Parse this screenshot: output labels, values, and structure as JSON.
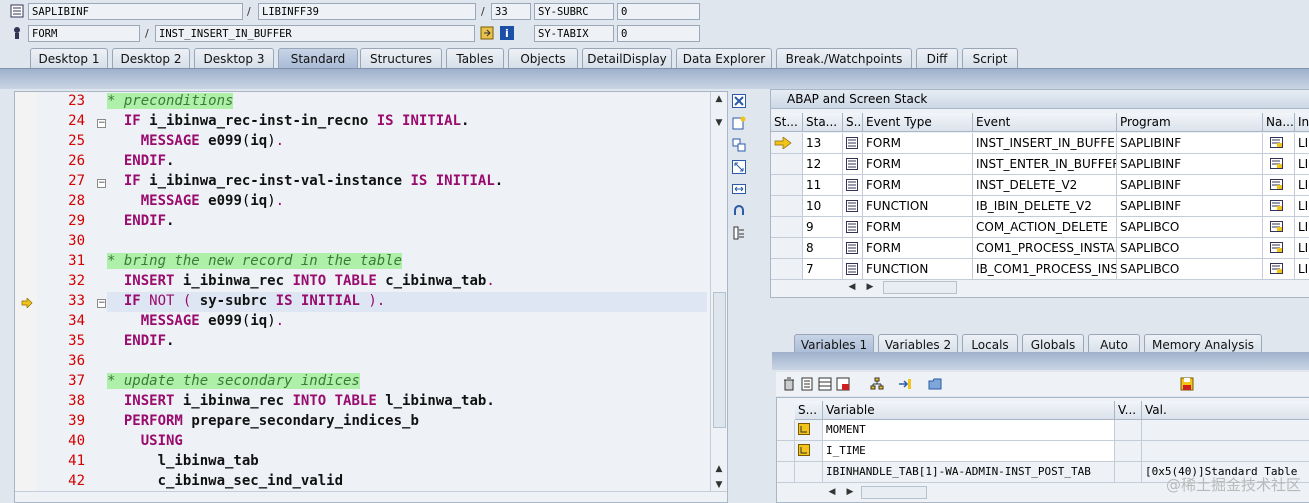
{
  "header": {
    "row1": {
      "program": "SAPLIBINF",
      "include": "LIBINFF39",
      "line": "33",
      "sysvar_label": "SY-SUBRC",
      "sysvar_value": "0"
    },
    "row2": {
      "type": "FORM",
      "event": "INST_INSERT_IN_BUFFER",
      "sysvar_label": "SY-TABIX",
      "sysvar_value": "0"
    }
  },
  "tabs": [
    "Desktop 1",
    "Desktop 2",
    "Desktop 3",
    "Standard",
    "Structures",
    "Tables",
    "Objects",
    "DetailDisplay",
    "Data Explorer",
    "Break./Watchpoints",
    "Diff",
    "Script"
  ],
  "active_tab": "Standard",
  "editor": {
    "line_numbers": [
      "23",
      "24",
      "25",
      "26",
      "27",
      "28",
      "29",
      "30",
      "31",
      "32",
      "33",
      "34",
      "35",
      "36",
      "37",
      "38",
      "39",
      "40",
      "41",
      "42"
    ],
    "current_line": "33"
  },
  "stack": {
    "title": "ABAP and Screen Stack",
    "columns": [
      "St...",
      "Sta...",
      "S...",
      "Event Type",
      "Event",
      "Program",
      "Na...",
      "In"
    ],
    "rows": [
      {
        "level": "13",
        "type": "FORM",
        "event": "INST_INSERT_IN_BUFFER",
        "program": "SAPLIBINF",
        "inc": "LIB"
      },
      {
        "level": "12",
        "type": "FORM",
        "event": "INST_ENTER_IN_BUFFER",
        "program": "SAPLIBINF",
        "inc": "LIB"
      },
      {
        "level": "11",
        "type": "FORM",
        "event": "INST_DELETE_V2",
        "program": "SAPLIBINF",
        "inc": "LIB"
      },
      {
        "level": "10",
        "type": "FUNCTION",
        "event": "IB_IBIN_DELETE_V2",
        "program": "SAPLIBINF",
        "inc": "LIB"
      },
      {
        "level": "9",
        "type": "FORM",
        "event": "COM_ACTION_DELETE",
        "program": "SAPLIBCO",
        "inc": "LIB"
      },
      {
        "level": "8",
        "type": "FORM",
        "event": "COM1_PROCESS_INSTA...",
        "program": "SAPLIBCO",
        "inc": "LIB"
      },
      {
        "level": "7",
        "type": "FUNCTION",
        "event": "IB_COM1_PROCESS_INS...",
        "program": "SAPLIBCO",
        "inc": "LIB"
      }
    ]
  },
  "var_tabs": [
    "Variables 1",
    "Variables 2",
    "Locals",
    "Globals",
    "Auto",
    "Memory Analysis"
  ],
  "active_var_tab": "Variables 1",
  "variables": {
    "columns": [
      "S...",
      "Variable",
      "V...",
      "Val."
    ],
    "rows": [
      {
        "name": "MOMENT",
        "value": ""
      },
      {
        "name": "I_TIME",
        "value": ""
      },
      {
        "name": "IBINHANDLE_TAB[1]-WA-ADMIN-INST_POST_TAB",
        "value": "[0x5(40)]Standard Table"
      }
    ]
  },
  "watermark": "@稀土掘金技术社区",
  "colors": {
    "accent": "#9a0b6e",
    "comment_bg": "#aef0a8",
    "line_number": "#d40000"
  }
}
